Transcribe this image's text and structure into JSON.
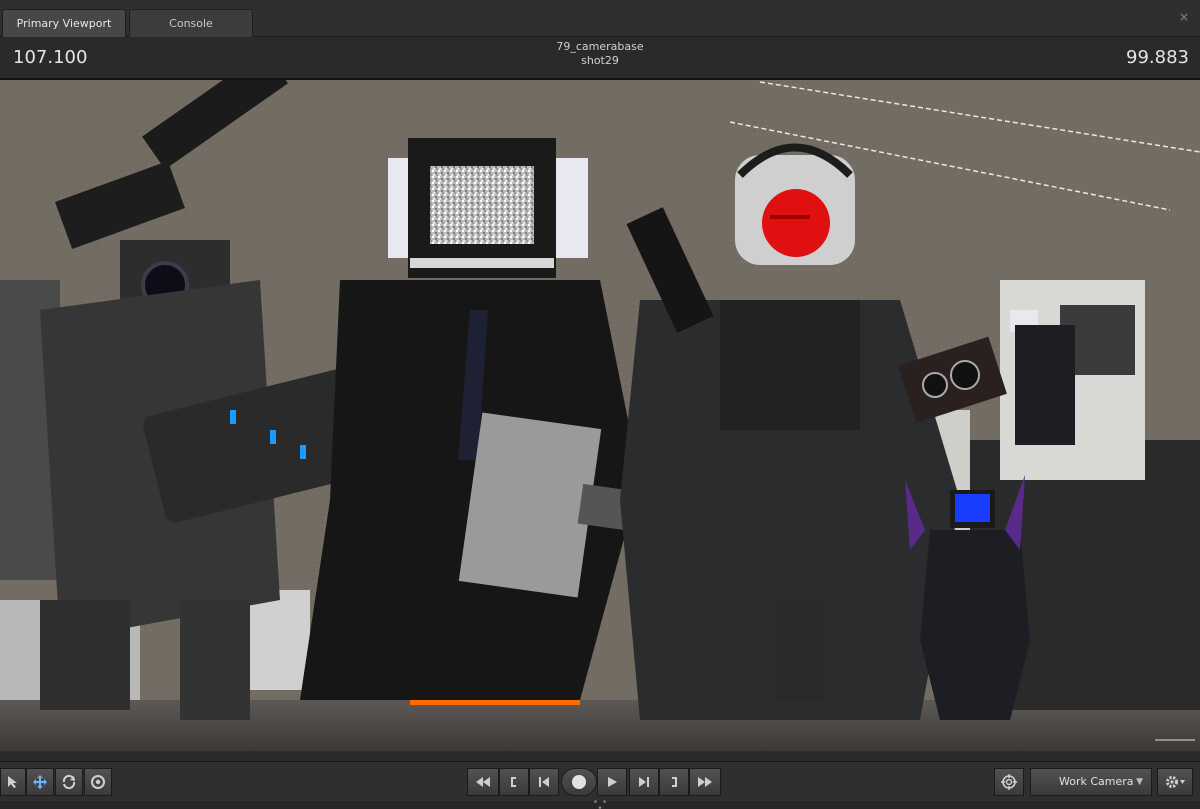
{
  "tabs": [
    {
      "label": "Primary Viewport",
      "active": true
    },
    {
      "label": "Console",
      "active": false
    }
  ],
  "close_glyph": "×",
  "info": {
    "left_value": "107.100",
    "right_value": "99.883",
    "title_line1": "79_camerabase",
    "title_line2": "shot29"
  },
  "toolbar": {
    "left_tools": [
      "select-arrow-icon",
      "move-icon",
      "rotate-icon",
      "target-icon"
    ],
    "transport": [
      "rewind-icon",
      "mark-in-icon",
      "skip-start-icon",
      "record-icon",
      "play-icon",
      "skip-end-icon",
      "mark-out-icon",
      "fast-forward-icon"
    ],
    "camera_select": "Work Camera",
    "camera_icon": "crosshair-icon",
    "settings_icon": "gear-icon"
  },
  "colors": {
    "accent_blue": "#6fb3ff",
    "robot_eye": "#e01010",
    "tv_screen_blue": "#1a3cff",
    "floor_glow": "#ff6a00"
  }
}
